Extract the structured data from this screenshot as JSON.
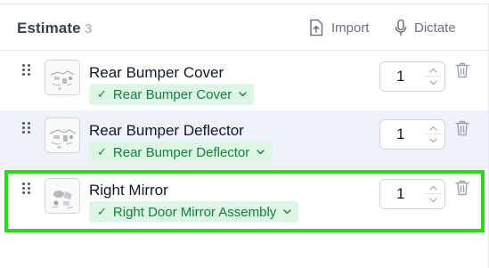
{
  "header": {
    "title": "Estimate",
    "count": "3",
    "import_label": "Import",
    "dictate_label": "Dictate"
  },
  "items": [
    {
      "name": "Rear Bumper Cover",
      "match": "Rear Bumper Cover",
      "quantity": "1",
      "icon": "part-thumbnail"
    },
    {
      "name": "Rear Bumper Deflector",
      "match": "Rear Bumper Deflector",
      "quantity": "1",
      "icon": "part-thumbnail"
    },
    {
      "name": "Right Mirror",
      "match": "Right Door Mirror Assembly",
      "quantity": "1",
      "icon": "part-thumbnail"
    }
  ],
  "colors": {
    "chip_bg": "#dcf5e4",
    "chip_text": "#15803d",
    "selected_row_bg": "#eef3fb",
    "highlight": "#22dd11"
  }
}
